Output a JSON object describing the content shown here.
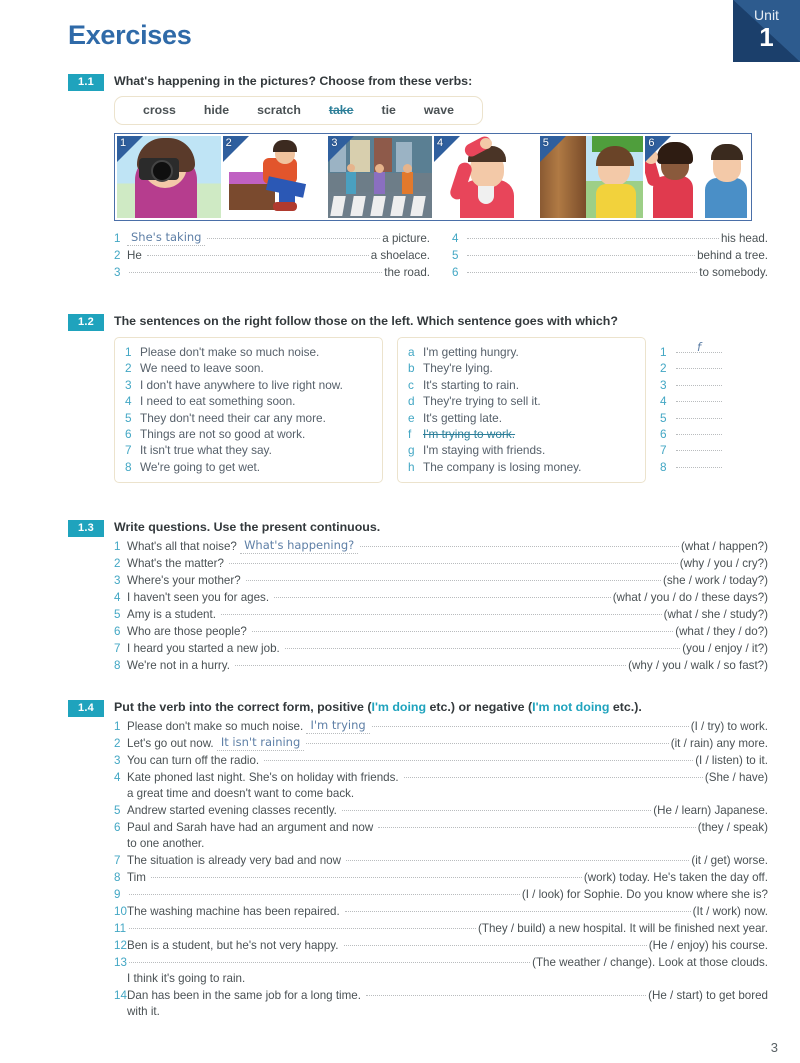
{
  "header": {
    "title": "Exercises",
    "unit_label": "Unit",
    "unit_number": "1"
  },
  "page_number": "3",
  "colors": {
    "title_blue": "#2f6aa8",
    "badge_teal": "#1fa3bd",
    "unit_navy": "#1b3f6b",
    "handwriting_blue": "#5e7fa6",
    "box_border_cream": "#ece3cd"
  },
  "exercise_1_1": {
    "number": "1.1",
    "title": "What's happening in the pictures?  Choose from these verbs:",
    "verbs": [
      {
        "word": "cross",
        "struck": false
      },
      {
        "word": "hide",
        "struck": false
      },
      {
        "word": "scratch",
        "struck": false
      },
      {
        "word": "take",
        "struck": true
      },
      {
        "word": "tie",
        "struck": false
      },
      {
        "word": "wave",
        "struck": false
      }
    ],
    "pictures": [
      {
        "num": "1",
        "alt": "woman-taking-photo"
      },
      {
        "num": "2",
        "alt": "man-tying-shoelace"
      },
      {
        "num": "3",
        "alt": "people-crossing-road"
      },
      {
        "num": "4",
        "alt": "man-scratching-head"
      },
      {
        "num": "5",
        "alt": "girl-hiding-behind-tree"
      },
      {
        "num": "6",
        "alt": "woman-waving"
      }
    ],
    "answers_left": [
      {
        "n": "1",
        "lead": "",
        "answer": "She's taking",
        "tail": "a picture."
      },
      {
        "n": "2",
        "lead": "He",
        "answer": "",
        "tail": "a shoelace."
      },
      {
        "n": "3",
        "lead": "",
        "answer": "",
        "tail": "the road."
      }
    ],
    "answers_right": [
      {
        "n": "4",
        "lead": "",
        "answer": "",
        "tail": "his head."
      },
      {
        "n": "5",
        "lead": "",
        "answer": "",
        "tail": "behind a tree."
      },
      {
        "n": "6",
        "lead": "",
        "answer": "",
        "tail": "to somebody."
      }
    ]
  },
  "exercise_1_2": {
    "number": "1.2",
    "title": "The sentences on the right follow those on the left.  Which sentence goes with which?",
    "left_items": [
      {
        "k": "1",
        "text": "Please don't make so much noise."
      },
      {
        "k": "2",
        "text": "We need to leave soon."
      },
      {
        "k": "3",
        "text": "I don't have anywhere to live right now."
      },
      {
        "k": "4",
        "text": "I need to eat something soon."
      },
      {
        "k": "5",
        "text": "They don't need their car any more."
      },
      {
        "k": "6",
        "text": "Things are not so good at work."
      },
      {
        "k": "7",
        "text": "It isn't true what they say."
      },
      {
        "k": "8",
        "text": "We're going to get wet."
      }
    ],
    "right_items": [
      {
        "k": "a",
        "text": "I'm getting hungry.",
        "struck": false
      },
      {
        "k": "b",
        "text": "They're lying.",
        "struck": false
      },
      {
        "k": "c",
        "text": "It's starting to rain.",
        "struck": false
      },
      {
        "k": "d",
        "text": "They're trying to sell it.",
        "struck": false
      },
      {
        "k": "e",
        "text": "It's getting late.",
        "struck": false
      },
      {
        "k": "f",
        "text": "I'm trying to work.",
        "struck": true
      },
      {
        "k": "g",
        "text": "I'm staying with friends.",
        "struck": false
      },
      {
        "k": "h",
        "text": "The company is losing money.",
        "struck": false
      }
    ],
    "answers": [
      {
        "k": "1",
        "value": "f"
      },
      {
        "k": "2",
        "value": ""
      },
      {
        "k": "3",
        "value": ""
      },
      {
        "k": "4",
        "value": ""
      },
      {
        "k": "5",
        "value": ""
      },
      {
        "k": "6",
        "value": ""
      },
      {
        "k": "7",
        "value": ""
      },
      {
        "k": "8",
        "value": ""
      }
    ]
  },
  "exercise_1_3": {
    "number": "1.3",
    "title": "Write questions.  Use the present continuous.",
    "items": [
      {
        "n": "1",
        "lead": "What's all that noise?",
        "answer": "What's happening?",
        "tail": "(what / happen?)"
      },
      {
        "n": "2",
        "lead": "What's the matter?",
        "answer": "",
        "tail": "(why / you / cry?)"
      },
      {
        "n": "3",
        "lead": "Where's your mother?",
        "answer": "",
        "tail": "(she / work / today?)"
      },
      {
        "n": "4",
        "lead": "I haven't seen you for ages.",
        "answer": "",
        "tail": "(what / you / do / these days?)"
      },
      {
        "n": "5",
        "lead": "Amy is a student.",
        "answer": "",
        "tail": "(what / she / study?)"
      },
      {
        "n": "6",
        "lead": "Who are those people?",
        "answer": "",
        "tail": "(what / they / do?)"
      },
      {
        "n": "7",
        "lead": "I heard you started a new job.",
        "answer": "",
        "tail": "(you / enjoy / it?)"
      },
      {
        "n": "8",
        "lead": "We're not in a hurry.",
        "answer": "",
        "tail": "(why / you / walk / so fast?)"
      }
    ]
  },
  "exercise_1_4": {
    "number": "1.4",
    "title_parts": [
      {
        "text": "Put the verb into the correct form, positive (",
        "highlight": false
      },
      {
        "text": "I'm doing",
        "highlight": true
      },
      {
        "text": " etc.) or negative (",
        "highlight": false
      },
      {
        "text": "I'm not doing",
        "highlight": true
      },
      {
        "text": " etc.).",
        "highlight": false
      }
    ],
    "items": [
      {
        "n": "1",
        "lead": "Please don't make so much noise.",
        "answer": "I'm trying",
        "tail": "(I / try) to work.",
        "sub": ""
      },
      {
        "n": "2",
        "lead": "Let's go out now.",
        "answer": "It isn't raining",
        "tail": "(it / rain) any more.",
        "sub": ""
      },
      {
        "n": "3",
        "lead": "You can turn off the radio.",
        "answer": "",
        "tail": "(I / listen) to it.",
        "sub": ""
      },
      {
        "n": "4",
        "lead": "Kate phoned last night.  She's on holiday with friends.",
        "answer": "",
        "tail": "(She / have)",
        "sub": "a great time and doesn't want to come back."
      },
      {
        "n": "5",
        "lead": "Andrew started evening classes recently.",
        "answer": "",
        "tail": "(He / learn) Japanese.",
        "sub": ""
      },
      {
        "n": "6",
        "lead": "Paul and Sarah have had an argument and now",
        "answer": "",
        "tail": "(they / speak)",
        "sub": "to one another."
      },
      {
        "n": "7",
        "lead": "The situation is already very bad and now",
        "answer": "",
        "tail": "(it / get) worse.",
        "sub": ""
      },
      {
        "n": "8",
        "lead": "Tim",
        "answer": "",
        "tail": "(work) today.  He's taken the day off.",
        "sub": ""
      },
      {
        "n": "9",
        "lead": "",
        "answer": "",
        "tail": "(I / look) for Sophie.  Do you know where she is?",
        "sub": ""
      },
      {
        "n": "10",
        "lead": "The washing machine has been repaired.",
        "answer": "",
        "tail": "(It / work) now.",
        "sub": ""
      },
      {
        "n": "11",
        "lead": "",
        "answer": "",
        "tail": "(They / build) a new hospital.  It will be finished next year.",
        "sub": ""
      },
      {
        "n": "12",
        "lead": "Ben is a student, but he's not very happy.",
        "answer": "",
        "tail": "(He / enjoy) his course.",
        "sub": ""
      },
      {
        "n": "13",
        "lead": "",
        "answer": "",
        "tail": "(The weather / change).  Look at those clouds.",
        "sub": "I think it's going to rain."
      },
      {
        "n": "14",
        "lead": "Dan has been in the same job for a long time.",
        "answer": "",
        "tail": "(He / start) to get bored",
        "sub": "with it."
      }
    ]
  }
}
